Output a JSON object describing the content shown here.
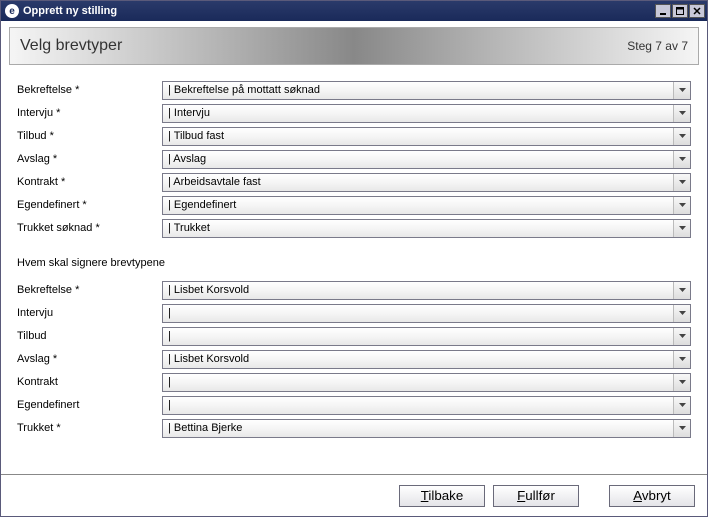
{
  "window": {
    "title": "Opprett ny stilling"
  },
  "header": {
    "title": "Velg brevtyper",
    "step": "Steg 7 av 7"
  },
  "letterTypes": {
    "rows": [
      {
        "label": "Bekreftelse *",
        "value": "| Bekreftelse på mottatt søknad"
      },
      {
        "label": "Intervju *",
        "value": "| Intervju"
      },
      {
        "label": "Tilbud *",
        "value": "| Tilbud fast"
      },
      {
        "label": "Avslag *",
        "value": "| Avslag"
      },
      {
        "label": "Kontrakt *",
        "value": "| Arbeidsavtale fast"
      },
      {
        "label": "Egendefinert *",
        "value": "| Egendefinert"
      },
      {
        "label": "Trukket søknad *",
        "value": "| Trukket"
      }
    ]
  },
  "signSection": {
    "label": "Hvem skal signere brevtypene",
    "rows": [
      {
        "label": "Bekreftelse *",
        "value": "| Lisbet Korsvold"
      },
      {
        "label": "Intervju",
        "value": "|"
      },
      {
        "label": "Tilbud",
        "value": "|"
      },
      {
        "label": "Avslag *",
        "value": "| Lisbet Korsvold"
      },
      {
        "label": "Kontrakt",
        "value": "|"
      },
      {
        "label": "Egendefinert",
        "value": "|"
      },
      {
        "label": "Trukket *",
        "value": "| Bettina Bjerke"
      }
    ]
  },
  "footer": {
    "back": "Tilbake",
    "finish": "Fullfør",
    "cancel": "Avbryt"
  }
}
